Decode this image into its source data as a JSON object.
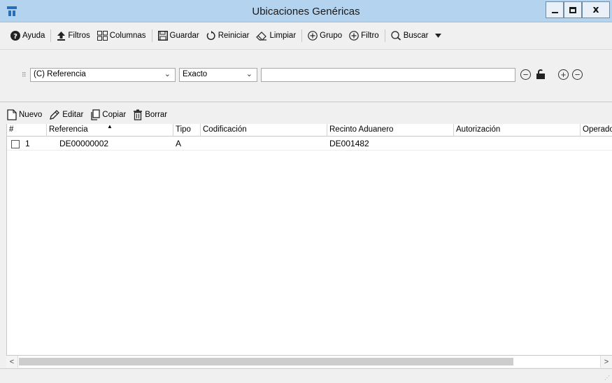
{
  "window": {
    "title": "Ubicaciones Genéricas"
  },
  "toolbar": {
    "help": "Ayuda",
    "filters": "Filtros",
    "columns": "Columnas",
    "save": "Guardar",
    "restart": "Reiniciar",
    "clear": "Limpiar",
    "group": "Grupo",
    "filter": "Filtro",
    "search": "Buscar"
  },
  "filter": {
    "field": "(C) Referencia",
    "operator": "Exacto",
    "value": ""
  },
  "actions": {
    "new": "Nuevo",
    "edit": "Editar",
    "copy": "Copiar",
    "delete": "Borrar"
  },
  "grid": {
    "columns": [
      "#",
      "Referencia",
      "Tipo",
      "Codificación",
      "Recinto Aduanero",
      "Autorización",
      "Operador"
    ],
    "rows": [
      {
        "num": "1",
        "referencia": "DE00000002",
        "tipo": "A",
        "codificacion": "",
        "recinto": "DE001482",
        "autorizacion": "",
        "operador": ""
      }
    ]
  }
}
